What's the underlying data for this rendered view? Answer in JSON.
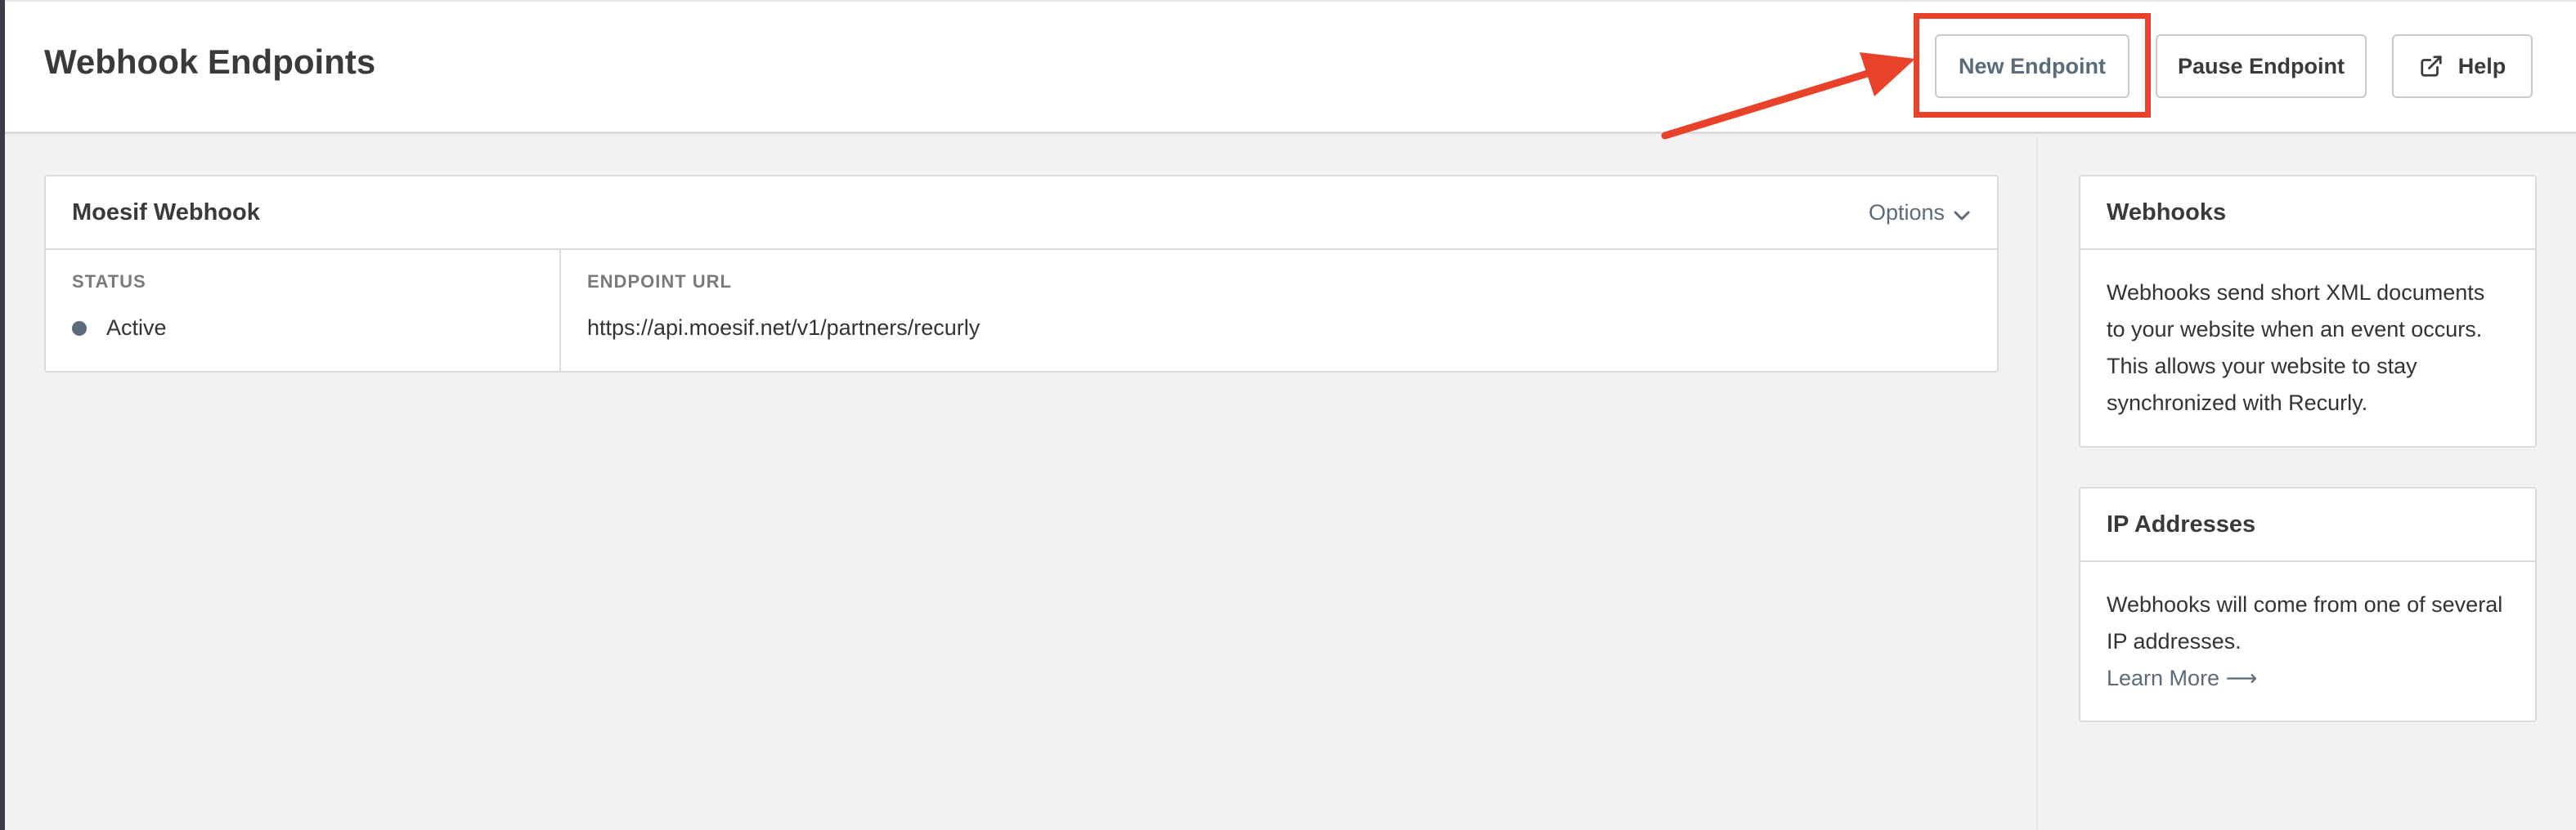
{
  "header": {
    "title": "Webhook Endpoints",
    "buttons": {
      "new_endpoint": "New Endpoint",
      "pause_endpoint": "Pause Endpoint",
      "help": "Help"
    }
  },
  "endpoint_card": {
    "title": "Moesif Webhook",
    "options_label": "Options",
    "status_label": "STATUS",
    "status_value": "Active",
    "url_label": "ENDPOINT URL",
    "url_value": "https://api.moesif.net/v1/partners/recurly"
  },
  "sidebar": {
    "webhooks": {
      "title": "Webhooks",
      "body": "Webhooks send short XML documents to your website when an event occurs. This allows your website to stay synchronized with Recurly."
    },
    "ip_addresses": {
      "title": "IP Addresses",
      "body": "Webhooks will come from one of several IP addresses.",
      "link": "Learn More ⟶"
    }
  },
  "colors": {
    "annotation": "#e8432a",
    "accent": "#5a6b7b"
  },
  "icons": {
    "help": "external-link-icon",
    "options": "chevron-down-icon",
    "status": "status-dot"
  }
}
